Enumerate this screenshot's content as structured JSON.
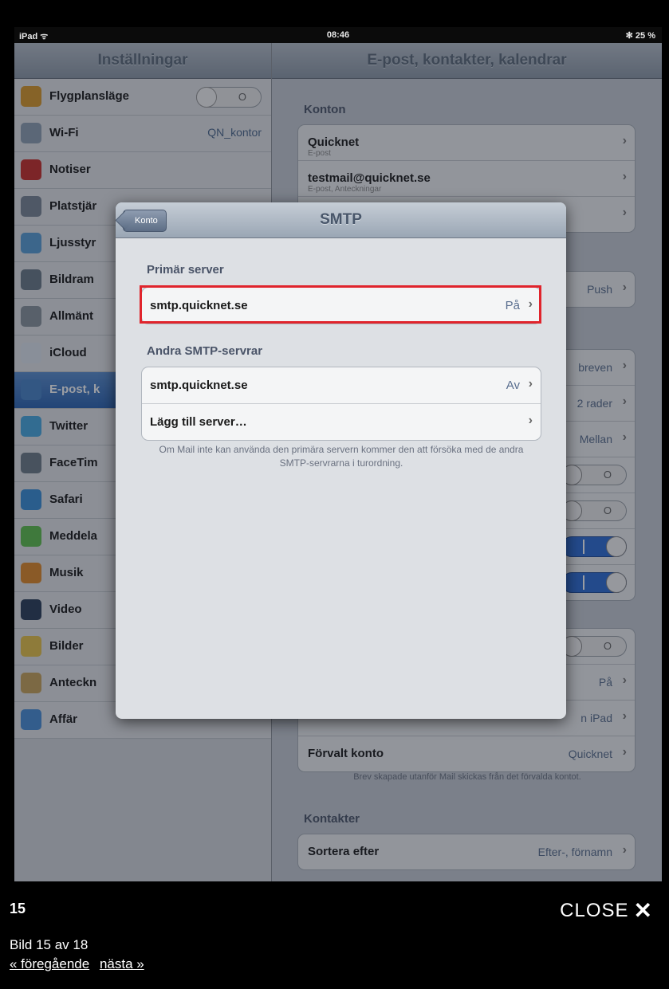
{
  "status_bar": {
    "device": "iPad ᯤ",
    "time": "08:46",
    "battery": "✻ 25 %"
  },
  "settings": {
    "title": "Inställningar",
    "items": [
      {
        "label": "Flygplansläge",
        "value": "",
        "toggle": "O",
        "icon": "airplane-icon",
        "color": "#d99a2b"
      },
      {
        "label": "Wi-Fi",
        "value": "QN_kontor",
        "toggle": "",
        "icon": "wifi-icon",
        "color": "#8fa0b3"
      },
      {
        "label": "Notiser",
        "value": "",
        "toggle": "",
        "icon": "notifications-icon",
        "color": "#c9302c"
      },
      {
        "label": "Platstjär",
        "value": "",
        "toggle": "",
        "icon": "location-icon",
        "color": "#7a8796"
      },
      {
        "label": "Ljusstyr",
        "value": "",
        "toggle": "",
        "icon": "brightness-icon",
        "color": "#5a9fd6"
      },
      {
        "label": "Bildram",
        "value": "",
        "toggle": "",
        "icon": "picture-frame-icon",
        "color": "#6c7a88"
      },
      {
        "label": "Allmänt",
        "value": "",
        "toggle": "",
        "icon": "gear-icon",
        "color": "#8a949e"
      },
      {
        "label": "iCloud",
        "value": "",
        "toggle": "",
        "icon": "cloud-icon",
        "color": "#dfe6ee"
      },
      {
        "label": "E-post, k",
        "value": "",
        "toggle": "",
        "icon": "mail-icon",
        "color": "#4a86c9",
        "selected": true
      },
      {
        "label": "Twitter",
        "value": "",
        "toggle": "",
        "icon": "twitter-icon",
        "color": "#49a9e0"
      },
      {
        "label": "FaceTim",
        "value": "",
        "toggle": "",
        "icon": "facetime-icon",
        "color": "#6f7c88"
      },
      {
        "label": "Safari",
        "value": "",
        "toggle": "",
        "icon": "safari-icon",
        "color": "#3b8fd8"
      },
      {
        "label": "Meddela",
        "value": "",
        "toggle": "",
        "icon": "messages-icon",
        "color": "#5fbf4f"
      },
      {
        "label": "Musik",
        "value": "",
        "toggle": "",
        "icon": "music-icon",
        "color": "#e08a2a"
      },
      {
        "label": "Video",
        "value": "",
        "toggle": "",
        "icon": "video-icon",
        "color": "#2c3e5a"
      },
      {
        "label": "Bilder",
        "value": "",
        "toggle": "",
        "icon": "photos-icon",
        "color": "#e7c34a"
      },
      {
        "label": "Anteckn",
        "value": "",
        "toggle": "",
        "icon": "notes-icon",
        "color": "#c9a45c"
      },
      {
        "label": "Affär",
        "value": "",
        "toggle": "",
        "icon": "store-icon",
        "color": "#4a8fd8"
      }
    ]
  },
  "mail_settings": {
    "title": "E-post, kontakter, kalendrar",
    "accounts_header": "Konton",
    "accounts": [
      {
        "title": "Quicknet",
        "subtitle": "E-post",
        "value": ""
      },
      {
        "title": "testmail@quicknet.se",
        "subtitle": "E-post, Anteckningar",
        "value": ""
      },
      {
        "title": "",
        "subtitle": "",
        "value": ""
      }
    ],
    "fetch_row": {
      "title": "",
      "value": "Push"
    },
    "mail_rows": [
      {
        "value": "breven",
        "kind": "value"
      },
      {
        "value": "2 rader",
        "kind": "value"
      },
      {
        "value": "Mellan",
        "kind": "value"
      },
      {
        "value": "O",
        "kind": "off"
      },
      {
        "value": "O",
        "kind": "off"
      },
      {
        "value": "I",
        "kind": "on"
      },
      {
        "value": "I",
        "kind": "on"
      }
    ],
    "mail_rows2": [
      {
        "value": "O",
        "kind": "off"
      },
      {
        "value": "På",
        "kind": "value"
      },
      {
        "value": "n iPad",
        "kind": "value"
      },
      {
        "title": "Förvalt konto",
        "value": "Quicknet",
        "kind": "value"
      }
    ],
    "default_note": "Brev skapade utanför Mail skickas från det förvalda kontot.",
    "contacts_header": "Kontakter",
    "contacts_rows": [
      {
        "title": "Sortera efter",
        "value": "Efter-, förnamn"
      }
    ]
  },
  "smtp_modal": {
    "back_label": "Konto",
    "title": "SMTP",
    "primary_header": "Primär server",
    "primary": {
      "host": "smtp.quicknet.se",
      "state": "På"
    },
    "other_header": "Andra SMTP-servrar",
    "others": [
      {
        "host": "smtp.quicknet.se",
        "state": "Av"
      },
      {
        "host": "Lägg till server…",
        "state": ""
      }
    ],
    "note": "Om Mail inte kan använda den primära servern kommer den att försöka med de andra SMTP-servrarna i turordning.",
    "chevron": "›",
    "highlight_color": "#e0242c"
  },
  "gallery": {
    "number": "15",
    "close_label": "CLOSE",
    "close_icon": "✕",
    "caption": "Bild 15 av 18",
    "prev": "« föregående",
    "next": "nästa »"
  }
}
